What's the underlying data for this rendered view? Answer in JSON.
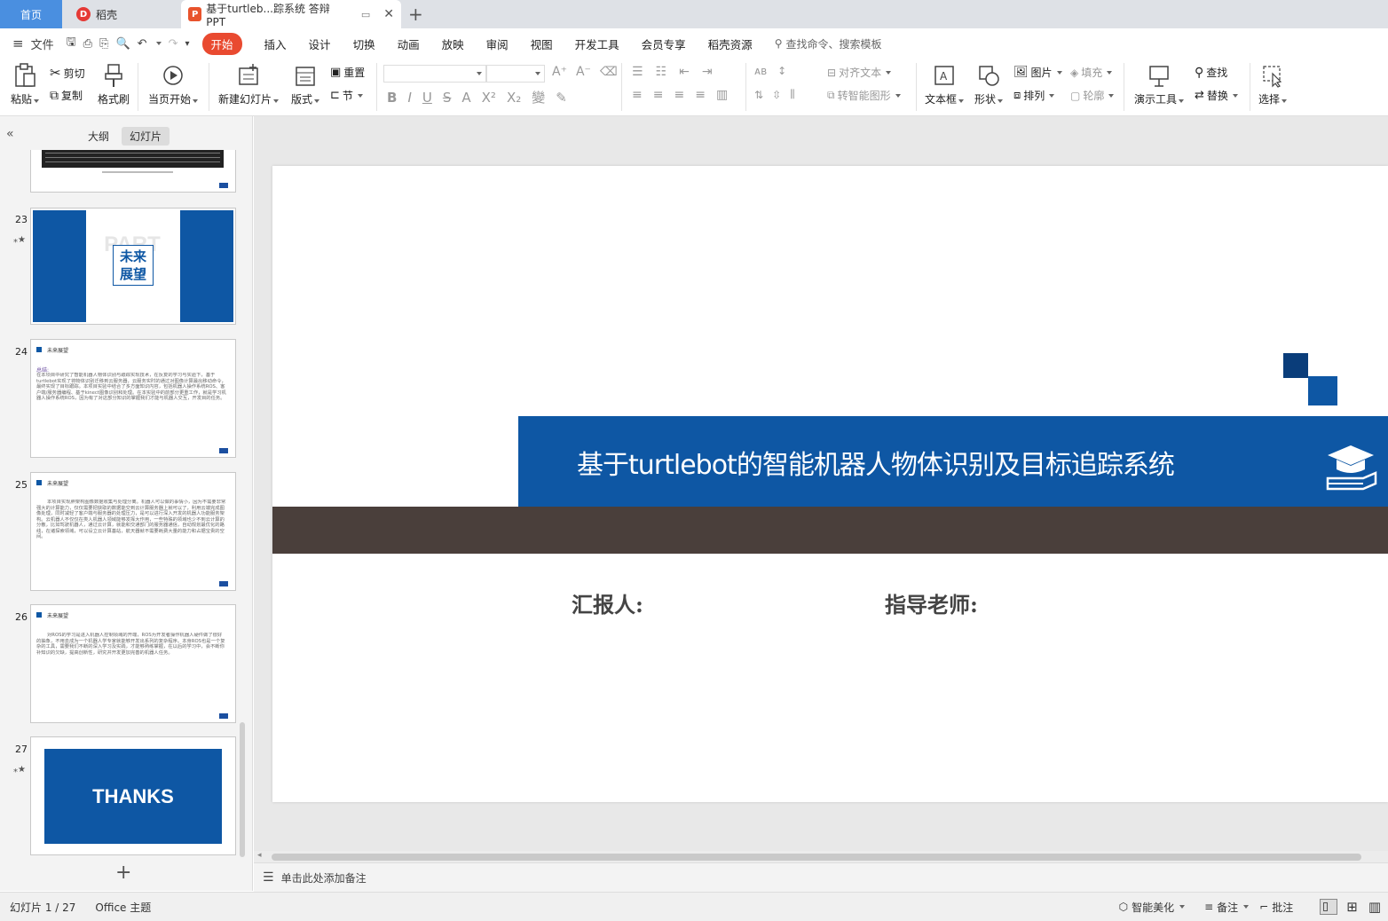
{
  "tabs": {
    "home": "首页",
    "daoke": "稻壳",
    "doc": "基于turtleb...踪系统 答辩PPT"
  },
  "menu": {
    "file": "文件",
    "items": [
      "开始",
      "插入",
      "设计",
      "切换",
      "动画",
      "放映",
      "审阅",
      "视图",
      "开发工具",
      "会员专享",
      "稻壳资源"
    ],
    "search_placeholder": "查找命令、搜索模板"
  },
  "ribbon": {
    "paste": "粘贴",
    "cut": "剪切",
    "copy": "复制",
    "format_painter": "格式刷",
    "from_current": "当页开始",
    "new_slide": "新建幻灯片",
    "layout": "版式",
    "reset": "重置",
    "section": "节",
    "align_text": "对齐文本",
    "smart_shape": "转智能图形",
    "textbox": "文本框",
    "shape": "形状",
    "picture": "图片",
    "arrange": "排列",
    "fill": "填充",
    "outline": "轮廓",
    "present_tools": "演示工具",
    "find": "查找",
    "replace": "替换",
    "select": "选择"
  },
  "sidebar": {
    "tab_outline": "大纲",
    "tab_slides": "幻灯片",
    "slides": [
      {
        "num": "23",
        "title": "未来\n展望",
        "bg_text": "PART SIX"
      },
      {
        "num": "24",
        "header": "未来展望",
        "subtitle": "总结:",
        "body": "在本项目中研究了智能机器人物体识别与跟踪实现技术，在反复的学习与实验下，基于turtlebot实现了将物体识别迁移到云服务器，云服务实时的通过对图像计算最出移动命令，最终实现了目标跟踪。本项目实验中结合了多方面知识内容，包括机器人操作系统ROS、客户端/服务器编程、基于kinect图像识别和处理。在本实验中的前部分更重工作，就是学习机器人操作系统ROS，因为有了对这部分知识的掌握我们才能与机器人交互，开发目的任务。",
        "page": "24"
      },
      {
        "num": "25",
        "header": "未来展望",
        "body": "本项目实现胖架构图像数据收集与处理分离。机器人可以做的事情小，因为不需要非常强大的计算能力，仅仅需要把获取的数据能交到云计算服务器上就可以了，利用云端完成图像处理，同时减轻了客户端与服务器的处理压力，是可以进行深入开发的机器人功能服务架构。云机器人不仅仅在类人机器人领域能够发挥大作用，一些特殊的领域也少不到云计算的分散，比如驾驶机器人，通过云计算，就能和交通部门的服务器通信，自动规划最优化的路线，在诸探索领域，可以设立云计算基站，航天器就不需要耗费大量的能力和占据宝贵的空间。",
        "page": "25"
      },
      {
        "num": "26",
        "header": "未来展望",
        "body": "对ROS的学习是进入机器人控制领域的开端，ROS为开发者操作机器人硬件做了很好的抽象，不用去成为一个机器人学专家就能够开发出系列的复杂程序。本身ROS也是一个复杂的工具，需要我们不断的深入学习及实践，才能够熟练掌握，在以后的学习中，会不断你补知识的欠缺，提高创新性，研究并开发更加完善的机器人任务。",
        "page": "26"
      },
      {
        "num": "27",
        "title": "THANKS"
      }
    ],
    "add_slide": "+"
  },
  "slide": {
    "title": "基于turtlebot的智能机器人物体识别及目标追踪系统",
    "reporter_label": "汇报人:",
    "advisor_label": "指导老师:"
  },
  "notes_placeholder": "单击此处添加备注",
  "status": {
    "slide_counter": "幻灯片 1 / 27",
    "theme": "Office 主题",
    "smart_beautify": "智能美化",
    "notes": "备注",
    "comments": "批注"
  },
  "colors": {
    "accent_blue": "#0e57a4",
    "dark_band": "#4a3f3b",
    "active_menu": "#e94a30",
    "home_tab": "#4a8fe0"
  }
}
